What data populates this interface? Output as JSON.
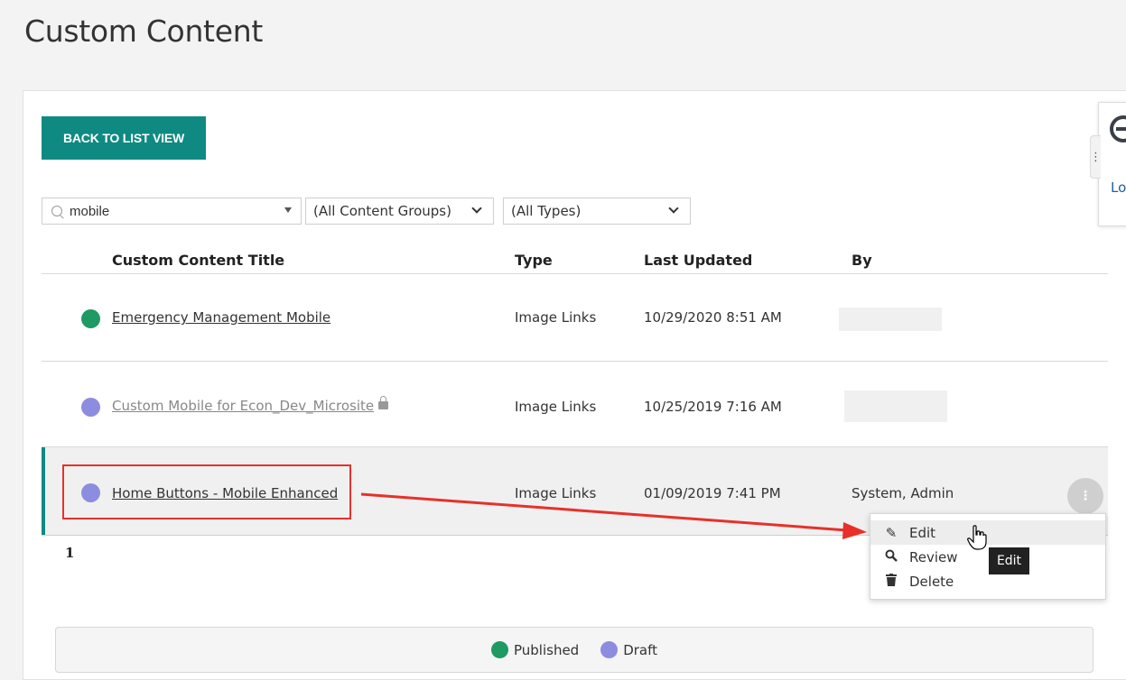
{
  "page_title": "Custom Content",
  "toolbar": {
    "back_label": "BACK TO LIST VIEW"
  },
  "filters": {
    "search_value": "mobile",
    "content_groups": "(All Content Groups)",
    "types": "(All Types)"
  },
  "table": {
    "headers": {
      "title": "Custom Content Title",
      "type": "Type",
      "updated": "Last Updated",
      "by": "By"
    },
    "rows": [
      {
        "title": "Emergency Management Mobile",
        "type": "Image Links",
        "updated": "10/29/2020 8:51 AM",
        "by": "",
        "status": "published",
        "locked": false
      },
      {
        "title": "Custom Mobile for Econ_Dev_Microsite",
        "type": "Image Links",
        "updated": "10/25/2019 7:16 AM",
        "by": "",
        "status": "draft",
        "locked": true
      },
      {
        "title": "Home Buttons - Mobile Enhanced",
        "type": "Image Links",
        "updated": "01/09/2019 7:41 PM",
        "by": "System, Admin",
        "status": "draft",
        "locked": false
      }
    ]
  },
  "context_menu": {
    "items": [
      {
        "label": "Edit",
        "icon": "pencil-icon"
      },
      {
        "label": "Review",
        "icon": "magnifier-icon"
      },
      {
        "label": "Delete",
        "icon": "trash-icon"
      }
    ],
    "tooltip": "Edit"
  },
  "pagination": {
    "current_page": "1"
  },
  "legend": {
    "published": "Published",
    "draft": "Draft"
  },
  "side_panel": {
    "text": "Lo"
  },
  "colors": {
    "accent": "#0e8a82",
    "published": "#1e9a62",
    "draft": "#8c8ce0",
    "annotation": "#e8302a"
  }
}
